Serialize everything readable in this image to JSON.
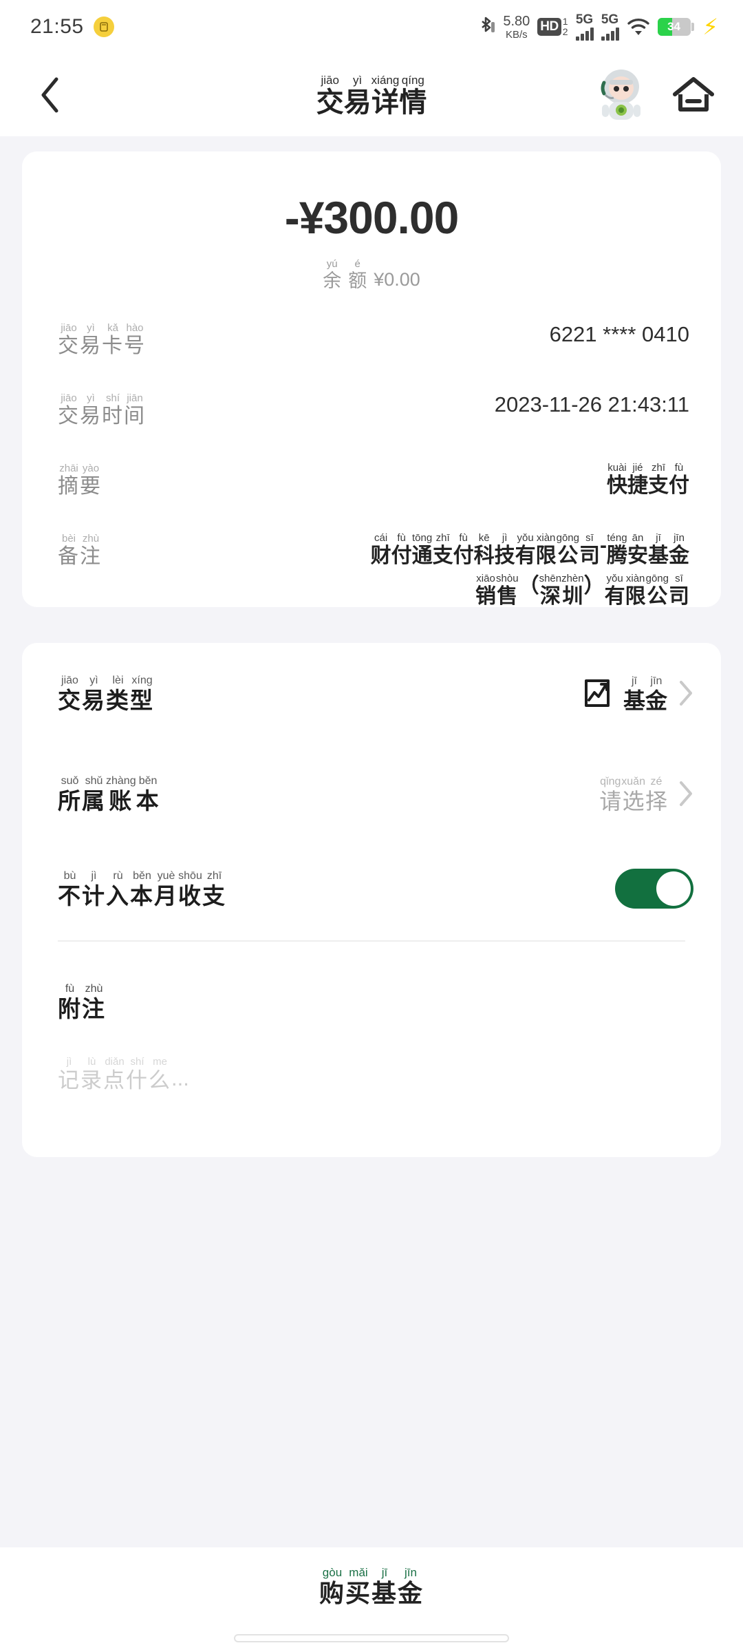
{
  "theme": {
    "page_bg": "#f4f4f8",
    "card_bg": "#ffffff",
    "accent_green": "#12703f",
    "battery_green": "#2bd24a",
    "coin_yellow": "#f5cf3c",
    "bolt_yellow": "#ffd400"
  },
  "status_bar": {
    "time": "21:55",
    "coin_icon": "coin-icon",
    "bluetooth_icon": "bluetooth-icon",
    "net_speed_value": "5.80",
    "net_speed_unit": "KB/s",
    "hd_label": "HD",
    "hd_slot_top": "1",
    "hd_slot_bottom": "2",
    "sim1_network": "5G",
    "sim2_network": "5G",
    "wifi_icon": "wifi-icon",
    "battery_percent": "34",
    "charging_icon": "charging-bolt-icon"
  },
  "header": {
    "back_icon": "back-chevron-icon",
    "title_pinyin": [
      "jiāo",
      "yì",
      "xiáng",
      "qíng"
    ],
    "title_chars": [
      "交",
      "易",
      "详",
      "情"
    ],
    "avatar_icon": "astronaut-mascot-avatar",
    "home_icon": "home-icon"
  },
  "summary": {
    "amount": "-¥300.00",
    "balance_pinyin": [
      "yú",
      "é"
    ],
    "balance_chars": [
      "余",
      "额"
    ],
    "balance_value": "¥0.00"
  },
  "details": [
    {
      "label_pinyin": [
        "jiāo",
        "yì",
        "kǎ",
        "hào"
      ],
      "label_chars": [
        "交",
        "易",
        "卡",
        "号"
      ],
      "value": "6221 **** 0410",
      "value_type": "plain",
      "name": "transaction-card-number"
    },
    {
      "label_pinyin": [
        "jiāo",
        "yì",
        "shí",
        "jiān"
      ],
      "label_chars": [
        "交",
        "易",
        "时",
        "间"
      ],
      "value": "2023-11-26 21:43:11",
      "value_type": "plain",
      "name": "transaction-time"
    },
    {
      "label_pinyin": [
        "zhāi",
        "yào"
      ],
      "label_chars": [
        "摘",
        "要"
      ],
      "value_type": "ruby",
      "value_lines": [
        {
          "pinyin": [
            "kuài",
            "jié",
            "zhī",
            "fù"
          ],
          "chars": [
            "快",
            "捷",
            "支",
            "付"
          ]
        }
      ],
      "name": "transaction-summary"
    },
    {
      "label_pinyin": [
        "bèi",
        "zhù"
      ],
      "label_chars": [
        "备",
        "注"
      ],
      "value_type": "ruby",
      "value_lines": [
        {
          "pinyin": [
            "cái",
            "fù",
            "tōng",
            "zhī",
            "fù",
            "kē",
            "jì",
            "yǒu",
            "xiàn",
            "gōng",
            "sī",
            "",
            "téng",
            "ān",
            "jī",
            "jīn"
          ],
          "chars": [
            "财",
            "付",
            "通",
            "支",
            "付",
            "科",
            "技",
            "有",
            "限",
            "公",
            "司",
            "-",
            "腾",
            "安",
            "基",
            "金"
          ]
        },
        {
          "pinyin": [
            "xiāo",
            "shòu",
            "",
            "shēn",
            "zhèn",
            "",
            "yǒu",
            "xiàn",
            "gōng",
            "sī"
          ],
          "chars": [
            "销",
            "售",
            "（",
            "深",
            "圳",
            "）",
            "有",
            "限",
            "公",
            "司"
          ]
        }
      ],
      "name": "transaction-remark"
    }
  ],
  "options": {
    "transaction_type": {
      "label_pinyin": [
        "jiāo",
        "yì",
        "lèi",
        "xíng"
      ],
      "label_chars": [
        "交",
        "易",
        "类",
        "型"
      ],
      "icon": "fund-trend-icon",
      "value_pinyin": [
        "jī",
        "jīn"
      ],
      "value_chars": [
        "基",
        "金"
      ],
      "chevron": "chevron-right-icon"
    },
    "ledger": {
      "label_pinyin": [
        "suǒ",
        "shǔ",
        "zhàng",
        "běn"
      ],
      "label_chars": [
        "所",
        "属",
        "账",
        "本"
      ],
      "value_pinyin": [
        "qǐng",
        "xuǎn",
        "zé"
      ],
      "value_chars": [
        "请",
        "选",
        "择"
      ],
      "chevron": "chevron-right-icon"
    },
    "exclude_toggle": {
      "label_pinyin": [
        "bù",
        "jì",
        "rù",
        "běn",
        "yuè",
        "shōu",
        "zhī"
      ],
      "label_chars": [
        "不",
        "计",
        "入",
        "本",
        "月",
        "收",
        "支"
      ],
      "state": "on"
    },
    "note": {
      "label_pinyin": [
        "fù",
        "zhù"
      ],
      "label_chars": [
        "附",
        "注"
      ],
      "placeholder_pinyin": [
        "jì",
        "lù",
        "diǎn",
        "shí",
        "me"
      ],
      "placeholder_chars": [
        "记",
        "录",
        "点",
        "什",
        "么"
      ],
      "placeholder_suffix": "...",
      "value": ""
    }
  },
  "bottom_bar": {
    "buy_pinyin": [
      "gòu",
      "mǎi",
      "jī",
      "jīn"
    ],
    "buy_chars": [
      "购",
      "买",
      "基",
      "金"
    ],
    "home_indicator": "home-indicator"
  }
}
